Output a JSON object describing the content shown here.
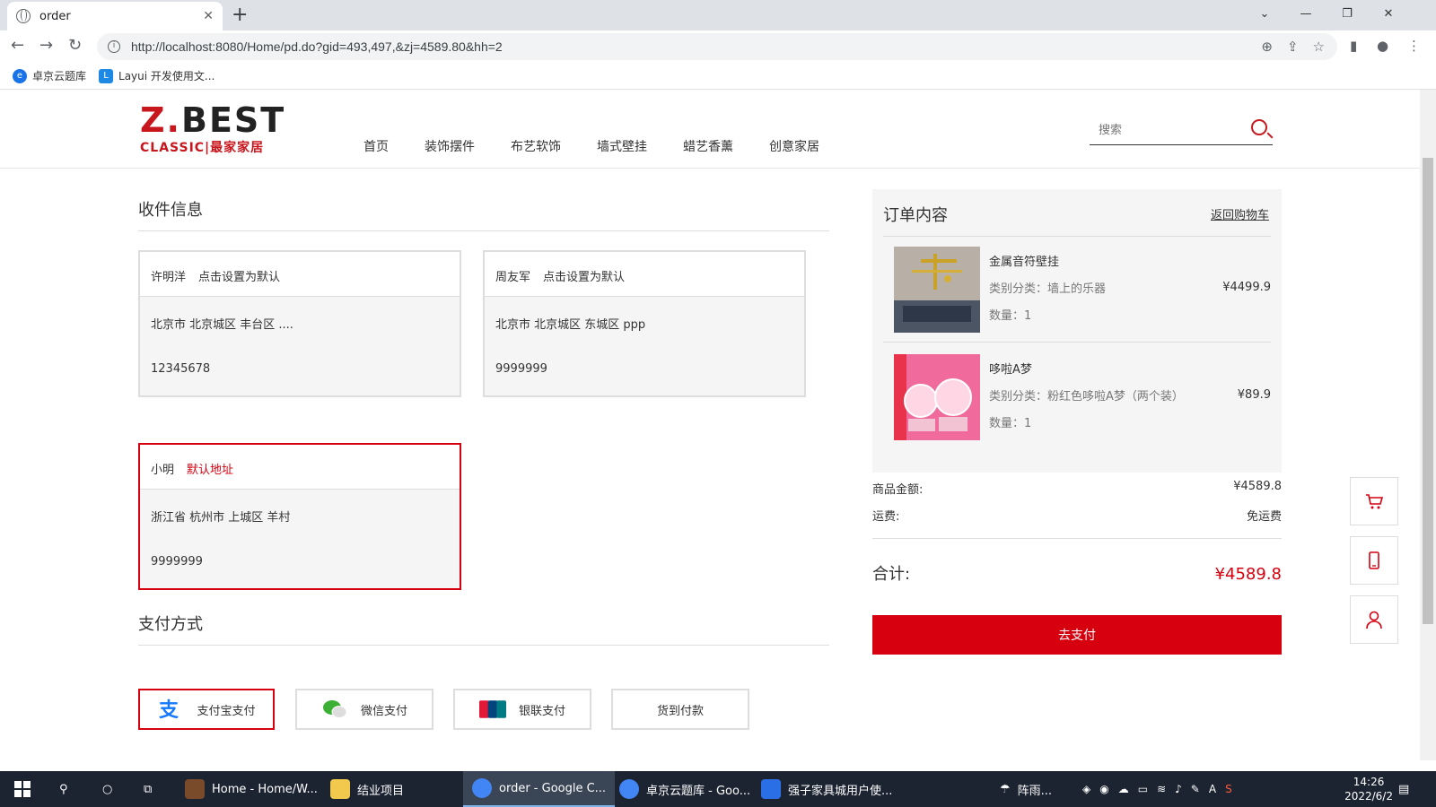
{
  "browser": {
    "tab_title": "order",
    "url": "http://localhost:8080/Home/pd.do?gid=493,497,&zj=4589.80&hh=2",
    "bookmarks": [
      "卓京云题库",
      "Layui 开发使用文..."
    ]
  },
  "site": {
    "logo_top": "Z.BEST",
    "logo_bottom": "CLASSIC|最家家居",
    "nav": [
      "首页",
      "装饰摆件",
      "布艺软饰",
      "墙式壁挂",
      "蜡艺香薰",
      "创意家居"
    ],
    "search_placeholder": "搜索"
  },
  "shipping": {
    "title": "收件信息",
    "addresses": [
      {
        "name": "许明洋",
        "tag": "点击设置为默认",
        "region": "北京市 北京城区 丰台区 ....",
        "phone": "12345678",
        "selected": false
      },
      {
        "name": "周友军",
        "tag": "点击设置为默认",
        "region": "北京市 北京城区 东城区 ppp",
        "phone": "9999999",
        "selected": false
      },
      {
        "name": "小明",
        "tag": "默认地址",
        "region": "浙江省 杭州市 上城区 羊村",
        "phone": "9999999",
        "selected": true
      }
    ]
  },
  "payment": {
    "title": "支付方式",
    "methods": [
      {
        "label": "支付宝支付",
        "icon": "alipay-icon",
        "selected": true
      },
      {
        "label": "微信支付",
        "icon": "wechat-icon",
        "selected": false
      },
      {
        "label": "银联支付",
        "icon": "unionpay-icon",
        "selected": false
      },
      {
        "label": "货到付款",
        "icon": "",
        "selected": false
      }
    ]
  },
  "order": {
    "title": "订单内容",
    "back_link": "返回购物车",
    "items": [
      {
        "name": "金属音符壁挂",
        "category": "类别分类：墙上的乐器",
        "qty": "数量：1",
        "price": "¥4499.9"
      },
      {
        "name": "哆啦A梦",
        "category": "类别分类：粉红色哆啦A梦（两个装）",
        "qty": "数量：1",
        "price": "¥89.9"
      }
    ],
    "goods_label": "商品金额:",
    "goods_amount": "¥4589.8",
    "shipping_label": "运费:",
    "shipping_value": "免运费",
    "total_label": "合计:",
    "total_value": "¥4589.8",
    "pay_button": "去支付"
  },
  "taskbar": {
    "items": [
      "Home - Home/W...",
      "结业项目",
      "order - Google C...",
      "卓京云题库 - Goo...",
      "强子家具城用户使..."
    ],
    "weather": "阵雨...",
    "time": "14:26",
    "date": "2022/6/2"
  },
  "colors": {
    "accent": "#d6000f",
    "border": "#dddddd",
    "panel": "#f5f5f5"
  }
}
